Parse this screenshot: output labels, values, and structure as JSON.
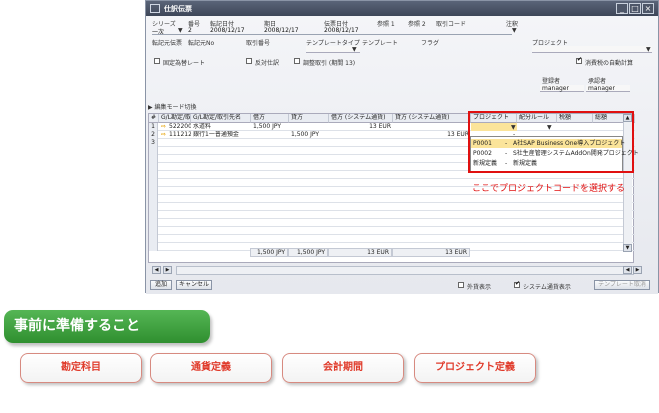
{
  "window": {
    "title": "仕訳伝票",
    "min_glyph": "_",
    "max_glyph": "□",
    "close_glyph": "×"
  },
  "header": {
    "series_label": "シリーズ",
    "series_value": "一次",
    "number_label": "番号",
    "number_value": "2",
    "posting_date_label": "転記日付",
    "posting_date_value": "2008/12/17",
    "due_date_label": "期日",
    "due_date_value": "2008/12/17",
    "doc_date_label": "伝票日付",
    "doc_date_value": "2008/12/17",
    "ref1_label": "参照 1",
    "ref2_label": "参照 2",
    "trans_code_label": "取引コード",
    "remarks_label": "注釈",
    "orig_label": "転記元伝票",
    "orig_no_label": "転記元No",
    "trans_no_label": "取引番号",
    "template_type_label": "テンプレートタイプ",
    "template_label": "テンプレート",
    "flag_label": "フラグ",
    "project_label": "プロジェクト",
    "fixed_rate_label": "固定為替レート",
    "reverse_label": "反対仕訳",
    "adjust_label": "調整取引 (期間 13)",
    "auto_tax_label": "消費税の自動計算",
    "registered_by_label": "登録者",
    "registered_by_value": "manager",
    "approver_label": "承認者",
    "approver_value": "manager"
  },
  "grid": {
    "section_label": "▶ 編集モード切換",
    "columns": [
      "#",
      "G/L勘定/取...",
      "G/L勘定/取引先名",
      "借方",
      "貸方",
      "借方 (システム通貨)",
      "貸方 (システム通貨)",
      "プロジェクト",
      "配分ルール",
      "税額",
      "総額"
    ],
    "rows": [
      {
        "n": "1",
        "acct": "522200",
        "name": "水道料",
        "debit": "1,500 JPY",
        "credit": "",
        "debit_sys": "13 EUR",
        "credit_sys": ""
      },
      {
        "n": "2",
        "acct": "111212",
        "name": "銀行1一普通預金",
        "debit": "",
        "credit": "1,500 JPY",
        "debit_sys": "",
        "credit_sys": "13 EUR"
      },
      {
        "n": "3",
        "acct": "",
        "name": "",
        "debit": "",
        "credit": "",
        "debit_sys": "",
        "credit_sys": ""
      }
    ],
    "totals": {
      "debit": "1,500 JPY",
      "credit": "1,500 JPY",
      "debit_sys": "13 EUR",
      "credit_sys": "13 EUR"
    },
    "dash": "-"
  },
  "popup": {
    "items": [
      {
        "code": "P0001",
        "sep": "-",
        "name": "A社SAP Business One導入プロジェクト"
      },
      {
        "code": "P0002",
        "sep": "-",
        "name": "S社生産管理システムAddOn開発プロジェクト"
      },
      {
        "code": "新規定義",
        "sep": "-",
        "name": "新規定義"
      }
    ]
  },
  "annotation": "ここでプロジェクトコードを選択する",
  "footer": {
    "add_label": "追加",
    "cancel_label": "キャンセル",
    "foreign_label": "外貨表示",
    "system_currency_label": "システム通貨表示",
    "template_btn_label": "テンプレート取消"
  },
  "prep": {
    "banner": "事前に準備すること",
    "buttons": [
      "勘定科目",
      "通貨定義",
      "会計期間",
      "プロジェクト定義"
    ]
  },
  "colors": {
    "highlight_red": "#e01010",
    "banner_green": "#3fa63f",
    "button_text": "#e03a2a",
    "popup_selected": "#fbe49a"
  }
}
